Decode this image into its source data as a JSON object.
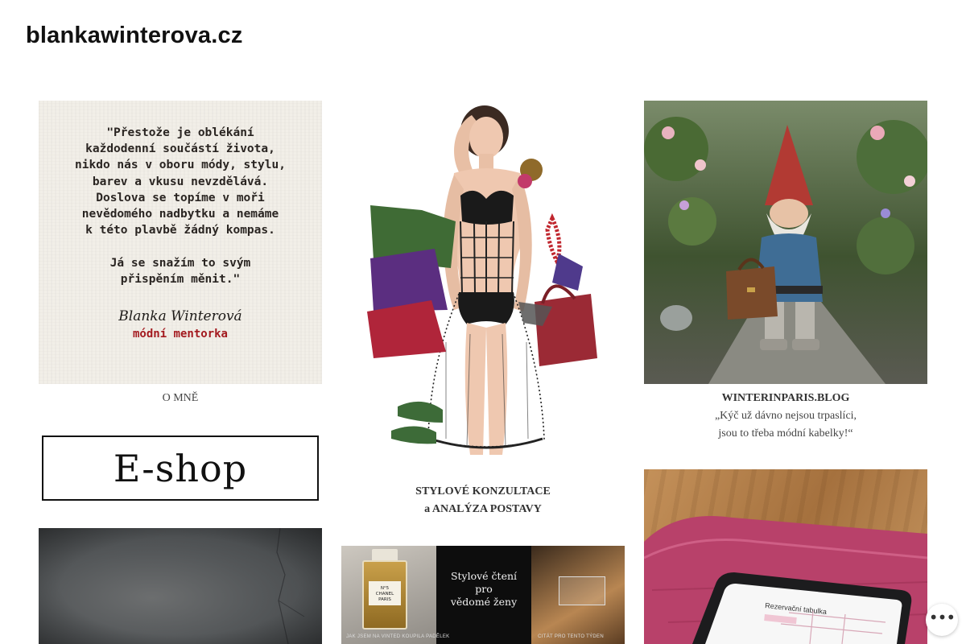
{
  "site": {
    "title": "blankawinterova.cz"
  },
  "tiles": {
    "quote": {
      "text": "\"Přestože je oblékání\nkaždodenní součástí života,\nnikdo nás v oboru módy, stylu,\nbarev a vkusu nevzdělává.\nDoslova se topíme v moři\nnevědomého nadbytku a nemáme\nk této plavbě žádný kompas.\n\nJá se snažím to svým\npřispěním měnit.\"",
      "signature": "Blanka Winterová",
      "role": "módní mentorka",
      "caption": "O MNĚ"
    },
    "eshop": {
      "label": "E-shop"
    },
    "woman": {
      "caption_line1": "STYLOVÉ KONZULTACE",
      "caption_line2": "a ANALÝZA POSTAVY",
      "colors": {
        "swatch_green": "#3f6b35",
        "swatch_purple": "#5b2e80",
        "swatch_red": "#b0253a",
        "bag": "#9b2a35",
        "shoes": "#3d6b38"
      }
    },
    "gnome": {
      "caption_line1": "WINTERINPARIS.BLOG",
      "caption_line2": "„Kýč už dávno nejsou trpaslíci,",
      "caption_line3": "jsou to třeba módní kabelky!“"
    },
    "collage": {
      "center_text": "Stylové čtení\npro\nvědomé ženy",
      "chanel_label": "N°5\nCHANEL\nPARIS",
      "footer_left": "JAK JSEM NA VINTED KOUPILA PADĚLEK",
      "footer_right": "CITÁT PRO TENTO TÝDEN"
    },
    "tablet": {
      "screen_title": "Rezervační tabulka"
    }
  },
  "actions": {
    "more_label": "•••"
  }
}
